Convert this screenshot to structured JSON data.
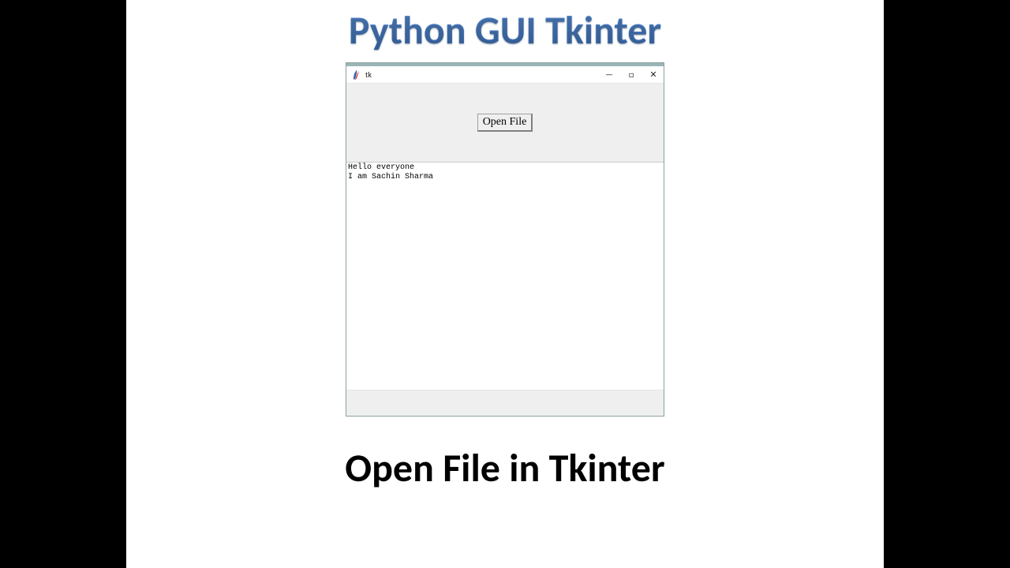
{
  "page": {
    "heading_top": "Python GUI Tkinter",
    "heading_bottom": "Open File in Tkinter"
  },
  "window": {
    "title": "tk",
    "buttons": {
      "minimize": "—",
      "maximize": "□",
      "close": "✕"
    },
    "open_file_label": "Open File",
    "text_content": "Hello everyone\nI am Sachin Sharma"
  }
}
